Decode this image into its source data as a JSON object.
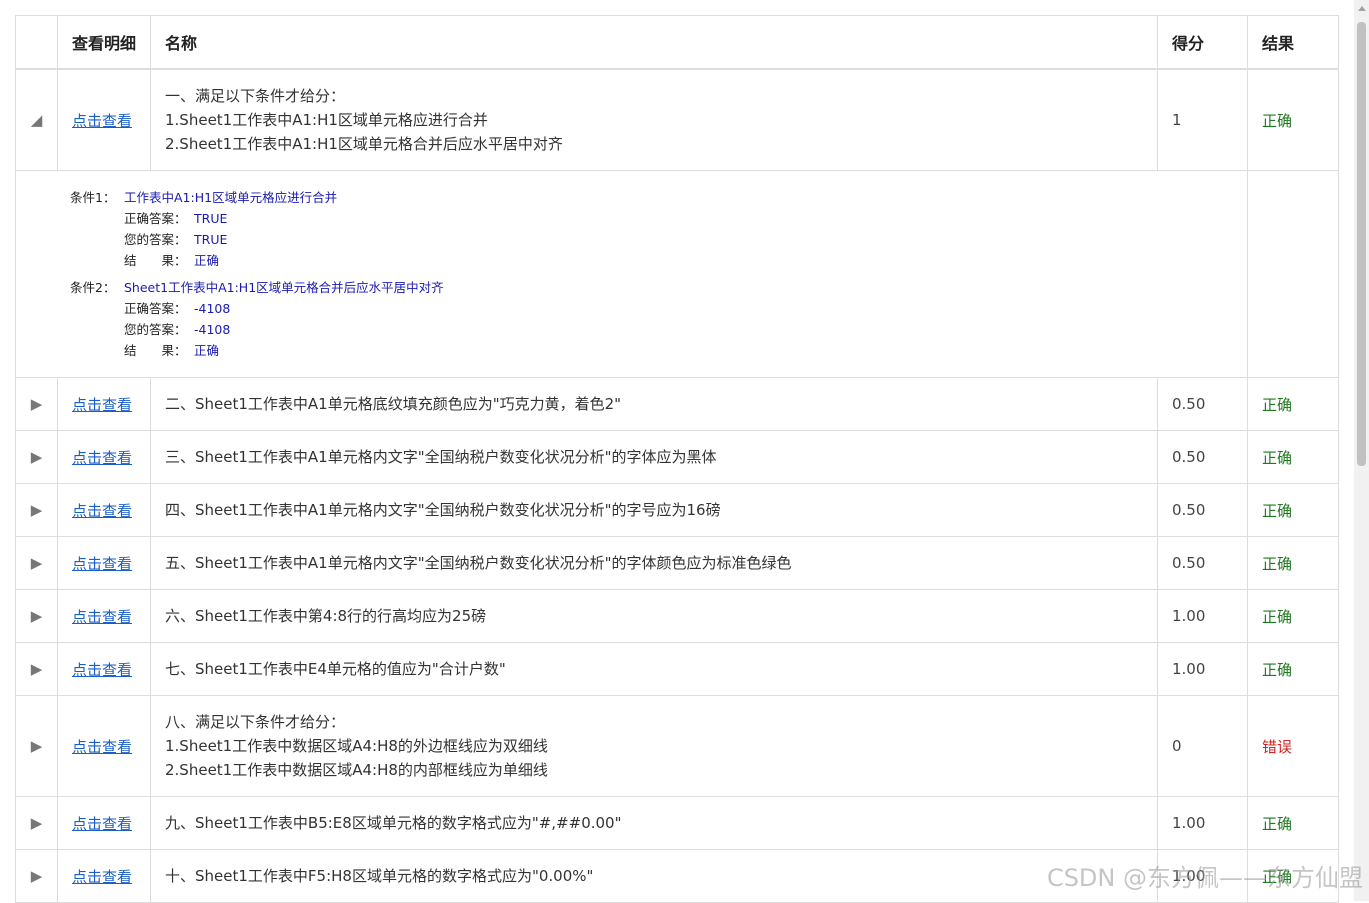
{
  "header": {
    "col_view": "查看明细",
    "col_name": "名称",
    "col_score": "得分",
    "col_result": "结果"
  },
  "rows": [
    {
      "arrow": "◢",
      "view": "点击查看",
      "name_lines": [
        "一、满足以下条件才给分：",
        "1.Sheet1工作表中A1:H1区域单元格应进行合并",
        "2.Sheet1工作表中A1:H1区域单元格合并后应水平居中对齐"
      ],
      "score": "1",
      "result": "正确"
    },
    {
      "arrow": "▶",
      "view": "点击查看",
      "name": "二、Sheet1工作表中A1单元格底纹填充颜色应为\"巧克力黄，着色2\"",
      "score": "0.50",
      "result": "正确"
    },
    {
      "arrow": "▶",
      "view": "点击查看",
      "name": "三、Sheet1工作表中A1单元格内文字\"全国纳税户数变化状况分析\"的字体应为黑体",
      "score": "0.50",
      "result": "正确"
    },
    {
      "arrow": "▶",
      "view": "点击查看",
      "name": "四、Sheet1工作表中A1单元格内文字\"全国纳税户数变化状况分析\"的字号应为16磅",
      "score": "0.50",
      "result": "正确"
    },
    {
      "arrow": "▶",
      "view": "点击查看",
      "name": "五、Sheet1工作表中A1单元格内文字\"全国纳税户数变化状况分析\"的字体颜色应为标准色绿色",
      "score": "0.50",
      "result": "正确"
    },
    {
      "arrow": "▶",
      "view": "点击查看",
      "name": "六、Sheet1工作表中第4:8行的行高均应为25磅",
      "score": "1.00",
      "result": "正确"
    },
    {
      "arrow": "▶",
      "view": "点击查看",
      "name": "七、Sheet1工作表中E4单元格的值应为\"合计户数\"",
      "score": "1.00",
      "result": "正确"
    },
    {
      "arrow": "▶",
      "view": "点击查看",
      "name_lines": [
        "八、满足以下条件才给分：",
        "1.Sheet1工作表中数据区域A4:H8的外边框线应为双细线",
        "2.Sheet1工作表中数据区域A4:H8的内部框线应为单细线"
      ],
      "score": "0",
      "result": "错误"
    },
    {
      "arrow": "▶",
      "view": "点击查看",
      "name": "九、Sheet1工作表中B5:E8区域单元格的数字格式应为\"#,##0.00\"",
      "score": "1.00",
      "result": "正确"
    },
    {
      "arrow": "▶",
      "view": "点击查看",
      "name": "十、Sheet1工作表中F5:H8区域单元格的数字格式应为\"0.00%\"",
      "score": "1.00",
      "result": "正确"
    }
  ],
  "detail": {
    "conditions": [
      {
        "label": "条件1：",
        "text": "工作表中A1:H1区域单元格应进行合并",
        "correct_label": "正确答案：",
        "correct": "TRUE",
        "yours_label": "您的答案：",
        "yours": "TRUE",
        "result_label": "结　　果：",
        "result": "正确"
      },
      {
        "label": "条件2：",
        "text": "Sheet1工作表中A1:H1区域单元格合并后应水平居中对齐",
        "correct_label": "正确答案：",
        "correct": "-4108",
        "yours_label": "您的答案：",
        "yours": "-4108",
        "result_label": "结　　果：",
        "result": "正确"
      }
    ]
  },
  "watermark": "CSDN @东方佩——东方仙盟",
  "colors": {
    "correct": "#1f7a1f",
    "wrong": "#d62020",
    "link": "#1a5ec9",
    "detail_value": "#1a1ab0"
  }
}
